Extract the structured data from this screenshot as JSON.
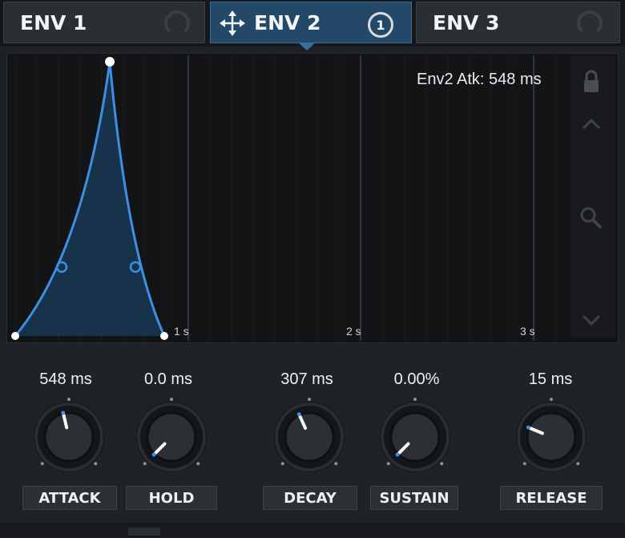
{
  "tabs": [
    {
      "label": "ENV 1",
      "active": false
    },
    {
      "label": "ENV 2",
      "active": true,
      "badge": "1"
    },
    {
      "label": "ENV 3",
      "active": false
    }
  ],
  "graph": {
    "readout": "Env2 Atk: 548 ms",
    "time_labels": [
      "1 s",
      "2 s",
      "3 s"
    ],
    "curve_color": "#3d8fe0"
  },
  "side_icons": [
    "lock-icon",
    "chevron-up-icon",
    "zoom-icon",
    "chevron-down-icon"
  ],
  "knobs": [
    {
      "name": "attack",
      "label": "ATTACK",
      "value": "548 ms",
      "level": 0.45
    },
    {
      "name": "hold",
      "label": "HOLD",
      "value": "0.0 ms",
      "level": 0.0
    },
    {
      "name": "decay",
      "label": "DECAY",
      "value": "307 ms",
      "level": 0.41
    },
    {
      "name": "sustain",
      "label": "SUSTAIN",
      "value": "0.00%",
      "level": 0.0
    },
    {
      "name": "release",
      "label": "RELEASE",
      "value": "15 ms",
      "level": 0.25
    }
  ]
}
